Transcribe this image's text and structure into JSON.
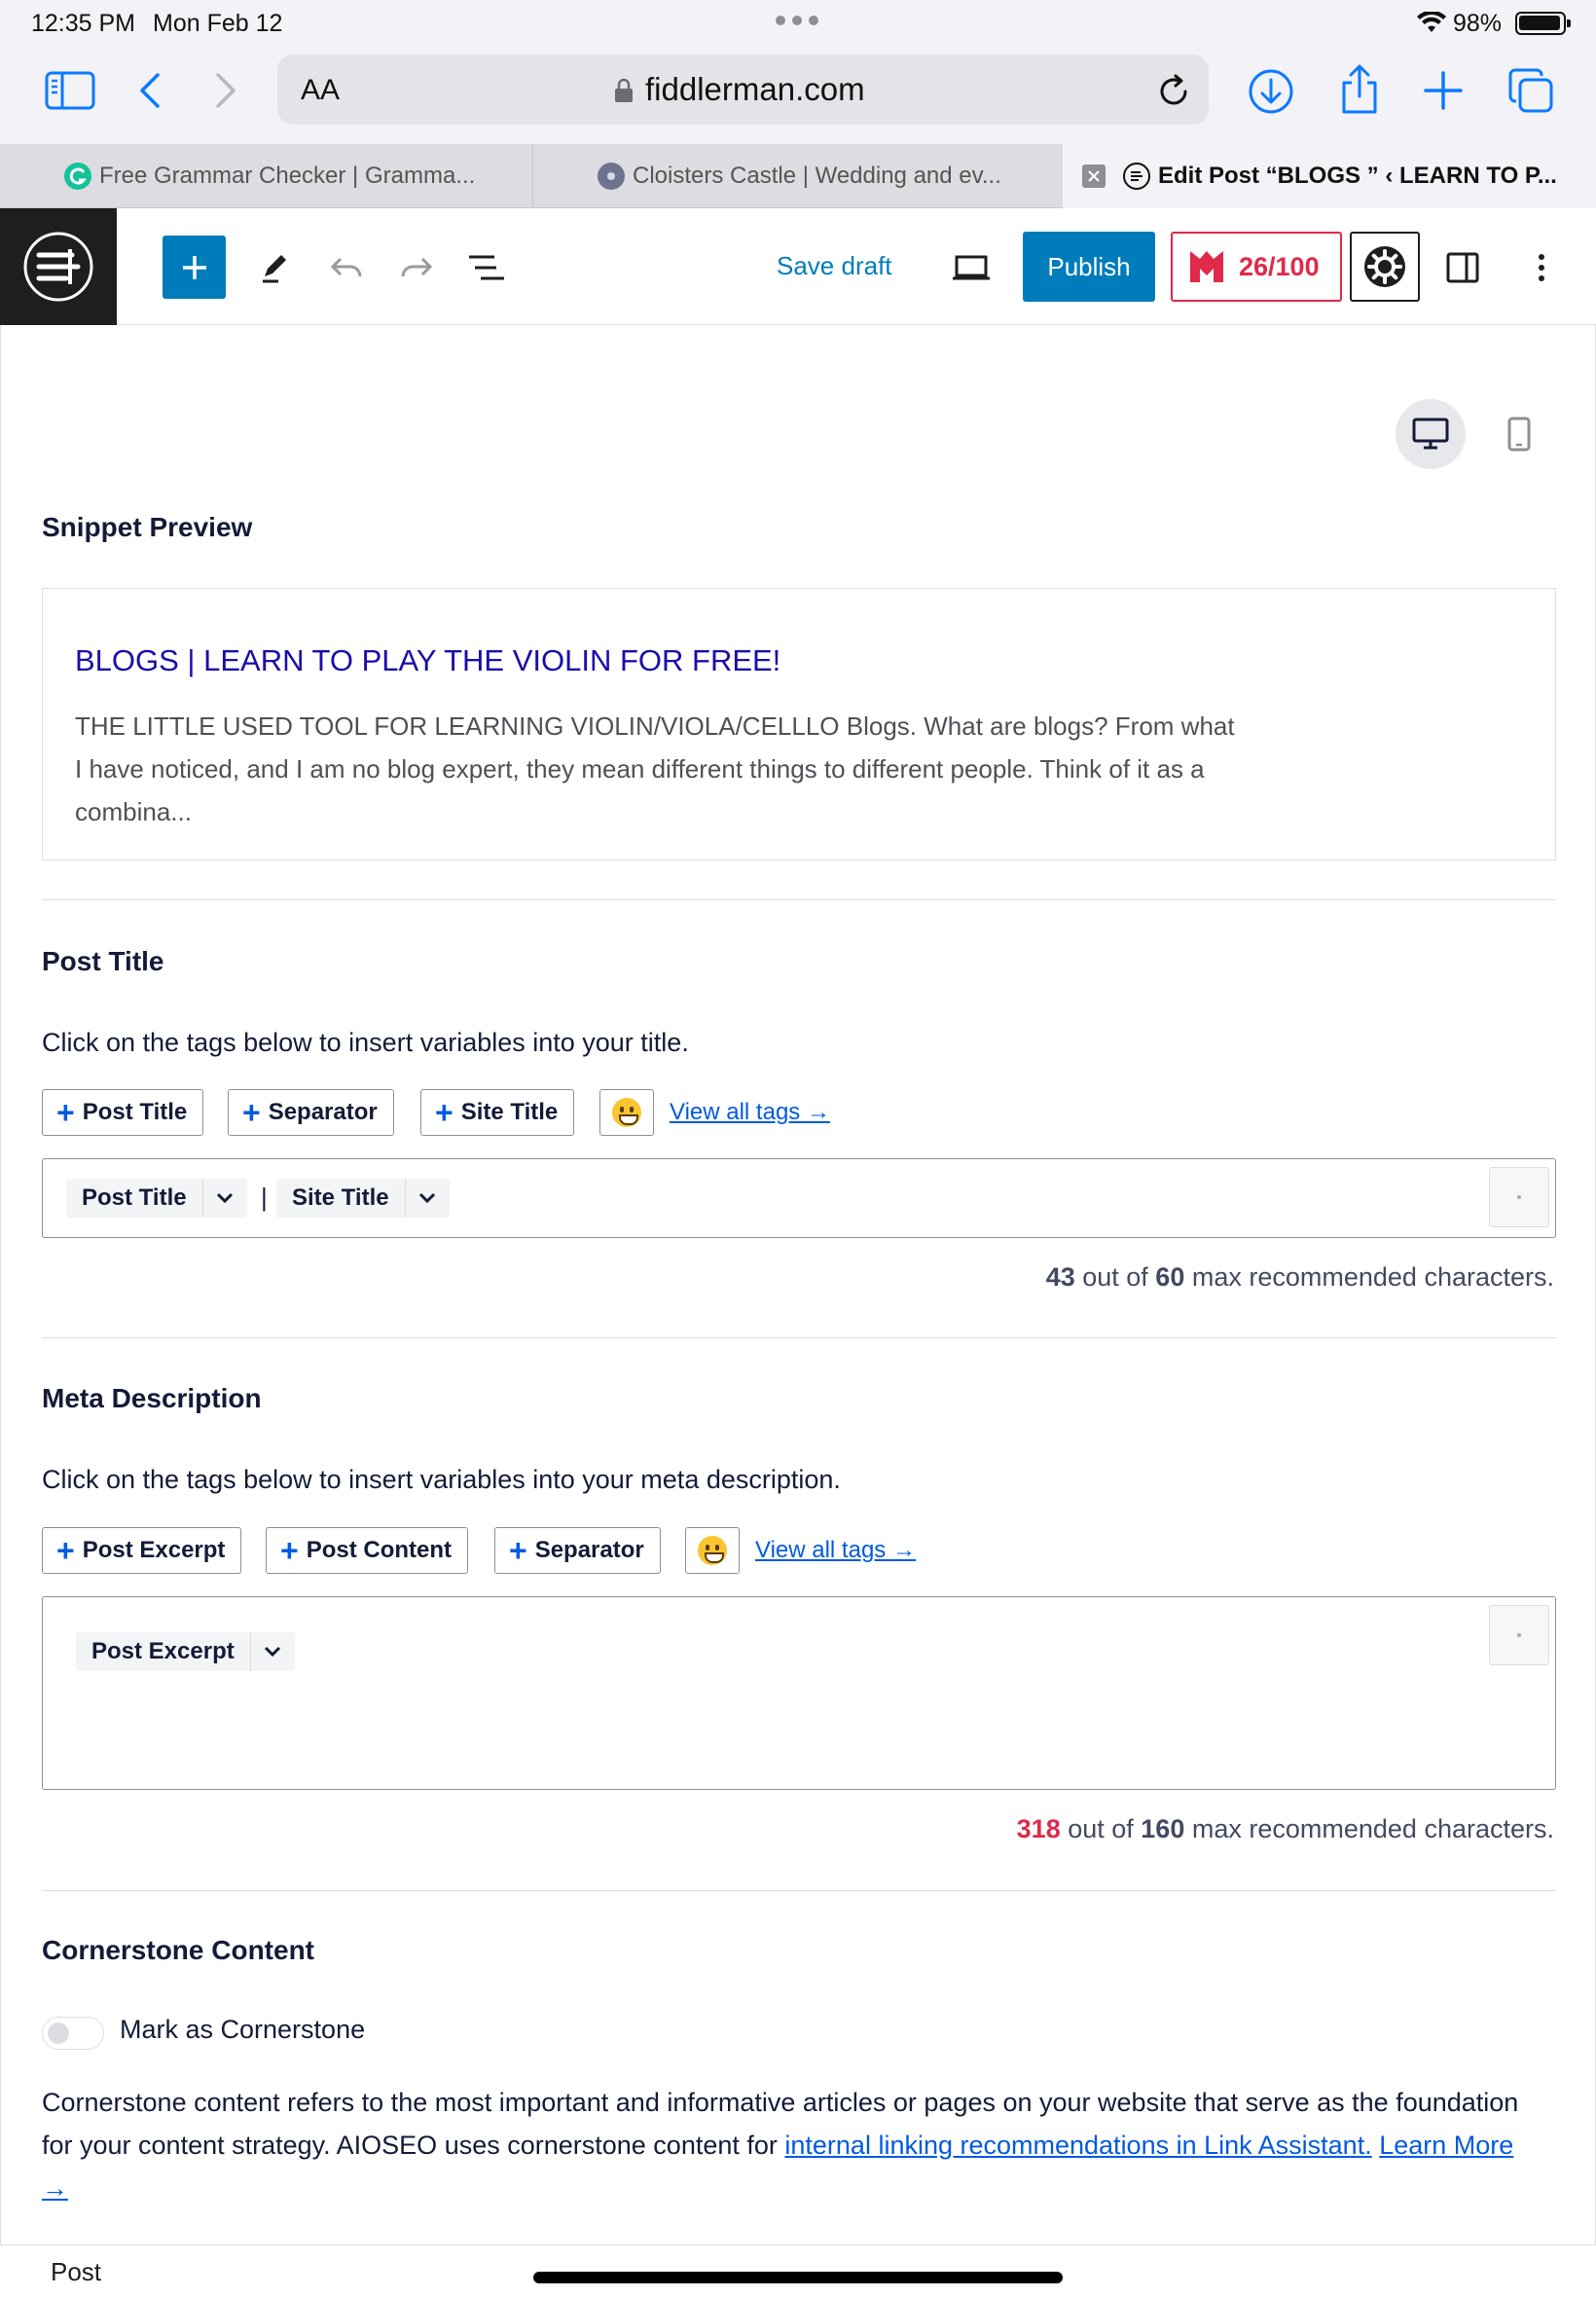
{
  "status_bar": {
    "time": "12:35 PM",
    "date": "Mon Feb 12",
    "battery": "98%"
  },
  "browser": {
    "url_text_size": "AA",
    "domain": "fiddlerman.com",
    "tabs": [
      {
        "title": "Free Grammar Checker | Gramma..."
      },
      {
        "title": "Cloisters Castle | Wedding and ev..."
      },
      {
        "title": "Edit Post “BLOGS ” ‹ LEARN TO P..."
      }
    ]
  },
  "editor_toolbar": {
    "save_draft": "Save draft",
    "publish": "Publish",
    "seo_score": "26/100"
  },
  "colors": {
    "wp_blue": "#007cba",
    "aioseo_red": "#df2a4a",
    "link_blue": "#005ae0",
    "snippet_title": "#1a0dab"
  },
  "snippet": {
    "heading": "Snippet Preview",
    "title": "BLOGS | LEARN TO PLAY THE VIOLIN FOR FREE!",
    "description": "THE LITTLE USED TOOL FOR LEARNING VIOLIN/VIOLA/CELLLO Blogs. What are blogs? From what I have noticed, and I am no blog expert, they mean different things to different people. Think of it as a combina..."
  },
  "post_title": {
    "heading": "Post Title",
    "instruction": "Click on the tags below to insert variables into your title.",
    "tag_buttons": [
      "Post Title",
      "Separator",
      "Site Title"
    ],
    "view_all": "View all tags →",
    "tokens": [
      "Post Title",
      "Site Title"
    ],
    "separator": "|",
    "count_current": "43",
    "count_text_a": " out of ",
    "count_max": "60",
    "count_text_b": " max recommended characters."
  },
  "meta_description": {
    "heading": "Meta Description",
    "instruction": "Click on the tags below to insert variables into your meta description.",
    "tag_buttons": [
      "Post Excerpt",
      "Post Content",
      "Separator"
    ],
    "view_all": "View all tags →",
    "tokens": [
      "Post Excerpt"
    ],
    "count_current": "318",
    "count_text_a": " out of ",
    "count_max": "160",
    "count_text_b": " max recommended characters."
  },
  "cornerstone": {
    "heading": "Cornerstone Content",
    "toggle_label": "Mark as Cornerstone",
    "toggle_on": false,
    "text_a": "Cornerstone content refers to the most important and informative articles or pages on your website that serve as the foundation for your content strategy. AIOSEO uses cornerstone content for ",
    "link_1": "internal linking recommendations in Link Assistant.",
    "link_2": "Learn More →"
  },
  "breadcrumb": "Post"
}
